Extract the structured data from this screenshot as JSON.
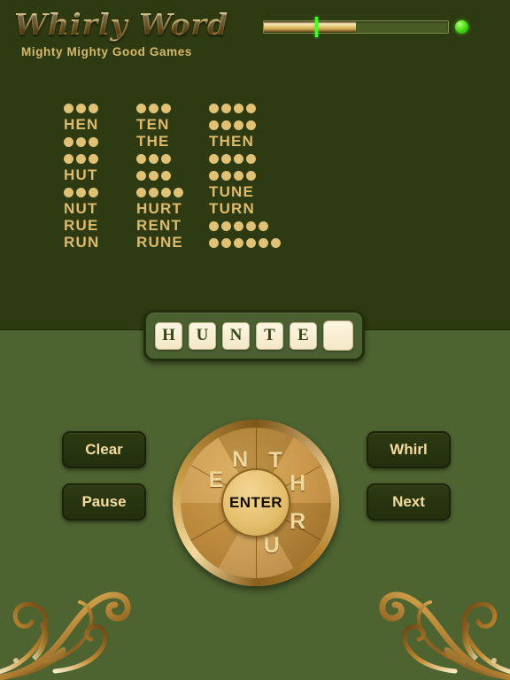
{
  "app": {
    "title": "Whirly Word",
    "subtitle": "Mighty Mighty Good Games",
    "background_dark": "#2e3a11",
    "background_light": "#4d6330",
    "gold": "#dcbb6c"
  },
  "progress": {
    "fill_percent": 50,
    "marker_percent": 28,
    "status_dot_color": "#4ee11a"
  },
  "word_list": {
    "columns": [
      {
        "rows": [
          {
            "type": "dots",
            "count": 3
          },
          {
            "type": "word",
            "text": "HEN"
          },
          {
            "type": "dots",
            "count": 3
          },
          {
            "type": "dots",
            "count": 3
          },
          {
            "type": "word",
            "text": "HUT"
          },
          {
            "type": "dots",
            "count": 3
          },
          {
            "type": "word",
            "text": "NUT"
          },
          {
            "type": "word",
            "text": "RUE"
          },
          {
            "type": "word",
            "text": "RUN"
          }
        ]
      },
      {
        "rows": [
          {
            "type": "dots",
            "count": 3
          },
          {
            "type": "word",
            "text": "TEN"
          },
          {
            "type": "word",
            "text": "THE"
          },
          {
            "type": "dots",
            "count": 3
          },
          {
            "type": "dots",
            "count": 3
          },
          {
            "type": "dots",
            "count": 4
          },
          {
            "type": "word",
            "text": "HURT"
          },
          {
            "type": "word",
            "text": "RENT"
          },
          {
            "type": "word",
            "text": "RUNE"
          }
        ]
      },
      {
        "rows": [
          {
            "type": "dots",
            "count": 4
          },
          {
            "type": "dots",
            "count": 4
          },
          {
            "type": "word",
            "text": "THEN"
          },
          {
            "type": "dots",
            "count": 4
          },
          {
            "type": "dots",
            "count": 4
          },
          {
            "type": "word",
            "text": "TUNE"
          },
          {
            "type": "word",
            "text": "TURN"
          },
          {
            "type": "dots",
            "count": 5
          },
          {
            "type": "dots",
            "count": 6
          }
        ]
      }
    ]
  },
  "tray": {
    "tiles": [
      {
        "letter": "H",
        "empty": false
      },
      {
        "letter": "U",
        "empty": false
      },
      {
        "letter": "N",
        "empty": false
      },
      {
        "letter": "T",
        "empty": false
      },
      {
        "letter": "E",
        "empty": false
      },
      {
        "letter": "",
        "empty": true
      }
    ]
  },
  "buttons": {
    "clear": "Clear",
    "pause": "Pause",
    "whirl": "Whirl",
    "next": "Next"
  },
  "wheel": {
    "center_label": "ENTER",
    "letters": [
      {
        "letter": "E",
        "angle": -60
      },
      {
        "letter": "N",
        "angle": -20
      },
      {
        "letter": "T",
        "angle": 25
      },
      {
        "letter": "H",
        "angle": 65
      },
      {
        "letter": "R",
        "angle": 115
      },
      {
        "letter": "U",
        "angle": 160
      }
    ]
  }
}
